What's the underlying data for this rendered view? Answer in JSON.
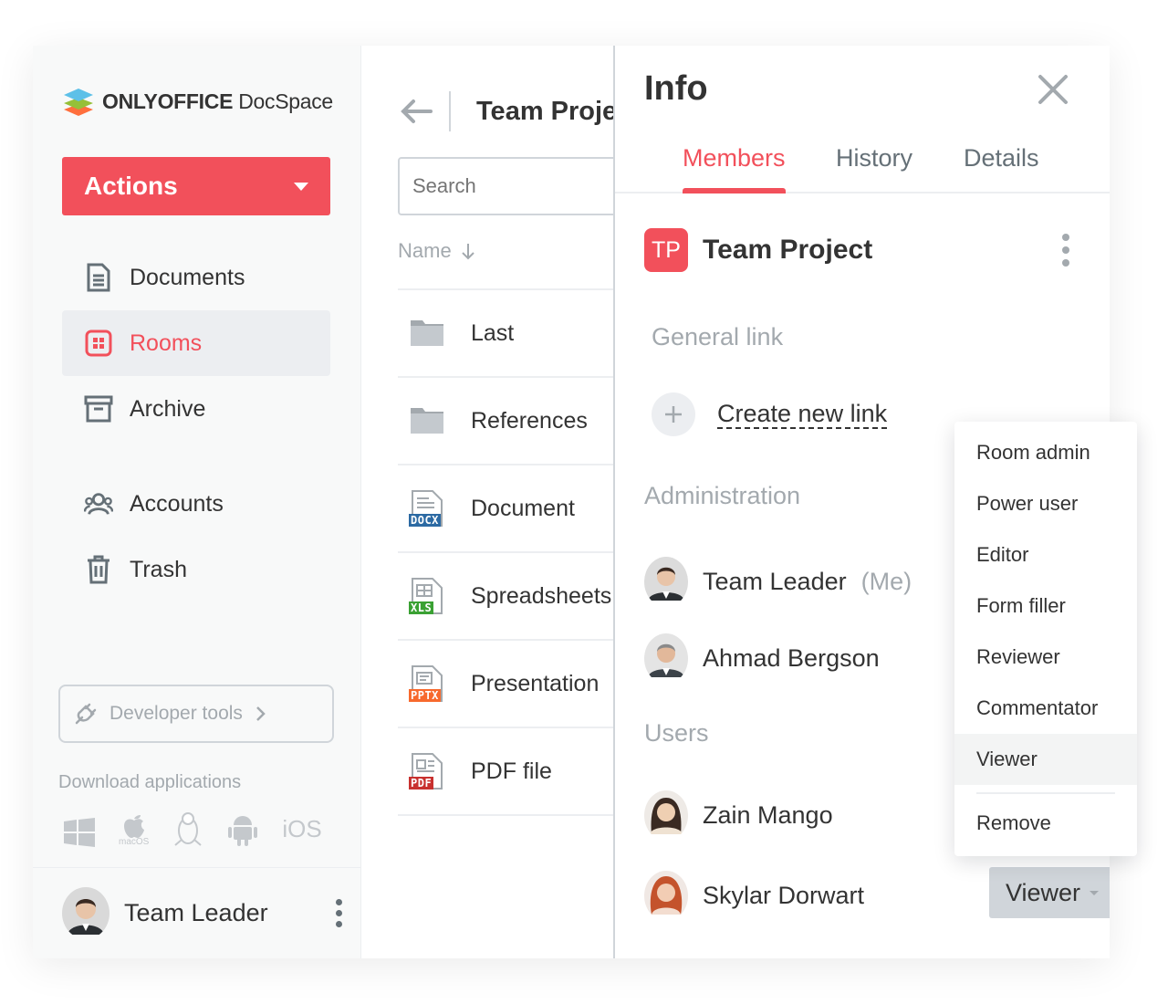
{
  "app": {
    "logo_bold": "ONLYOFFICE",
    "logo_light": " DocSpace"
  },
  "sidebar": {
    "actions_label": "Actions",
    "items": [
      {
        "label": "Documents",
        "icon": "document-icon"
      },
      {
        "label": "Rooms",
        "icon": "rooms-icon",
        "active": true
      },
      {
        "label": "Archive",
        "icon": "archive-icon"
      },
      {
        "label": "Accounts",
        "icon": "accounts-icon"
      },
      {
        "label": "Trash",
        "icon": "trash-icon"
      }
    ],
    "developer_tools": "Developer tools",
    "download_title": "Download applications",
    "apps": {
      "macos": "macOS",
      "ios": "iOS"
    },
    "profile_name": "Team Leader"
  },
  "filelist": {
    "title": "Team Project",
    "search_placeholder": "Search",
    "sort_label": "Name",
    "files": [
      {
        "name": "Last",
        "type": "folder"
      },
      {
        "name": "References",
        "type": "folder"
      },
      {
        "name": "Document",
        "type": "docx",
        "badge": "DOCX"
      },
      {
        "name": "Spreadsheets",
        "type": "xls",
        "badge": "XLS"
      },
      {
        "name": "Presentation",
        "type": "pptx",
        "badge": "PPTX"
      },
      {
        "name": "PDF file",
        "type": "pdf",
        "badge": "PDF"
      }
    ]
  },
  "info": {
    "title": "Info",
    "tabs": [
      "Members",
      "History",
      "Details"
    ],
    "room_badge": "TP",
    "room_name": "Team Project",
    "general_link": "General link",
    "create_link": "Create new link",
    "administration": "Administration",
    "admins": [
      {
        "name": "Team Leader",
        "suffix": "(Me)"
      },
      {
        "name": "Ahmad Bergson"
      }
    ],
    "users_title": "Users",
    "users": [
      {
        "name": "Zain Mango"
      },
      {
        "name": "Skylar Dorwart",
        "role": "Viewer"
      }
    ]
  },
  "role_menu": {
    "items": [
      "Room admin",
      "Power user",
      "Editor",
      "Form filler",
      "Reviewer",
      "Commentator",
      "Viewer"
    ],
    "selected": "Viewer",
    "remove": "Remove"
  },
  "colors": {
    "accent": "#f2505b",
    "muted": "#a3a9ae",
    "text": "#333333",
    "border": "#d0d5da"
  }
}
